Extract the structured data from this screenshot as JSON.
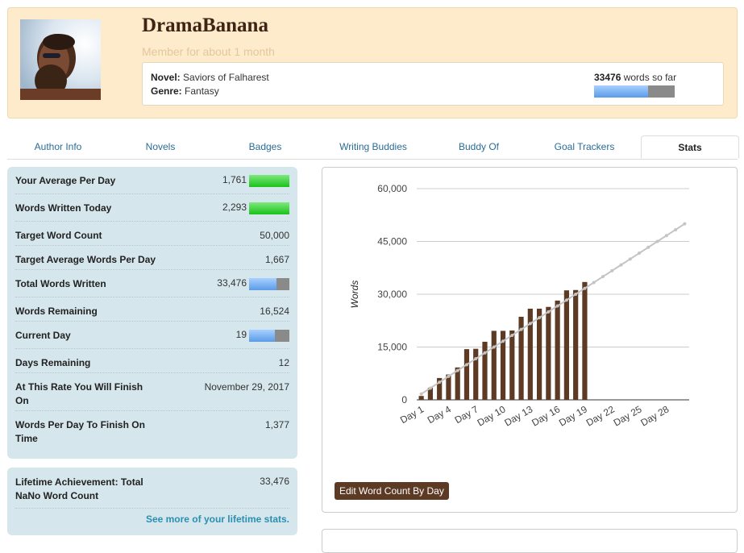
{
  "profile": {
    "username": "DramaBanana",
    "member_since": "Member for about 1 month",
    "novel_label": "Novel:",
    "novel_title": "Saviors of Falharest",
    "genre_label": "Genre:",
    "genre": "Fantasy",
    "words_count": "33476",
    "words_suffix": "words so far",
    "progress_fraction": 0.67
  },
  "tabs": [
    {
      "label": "Author Info",
      "active": false
    },
    {
      "label": "Novels",
      "active": false
    },
    {
      "label": "Badges",
      "active": false
    },
    {
      "label": "Writing Buddies",
      "active": false
    },
    {
      "label": "Buddy Of",
      "active": false
    },
    {
      "label": "Goal Trackers",
      "active": false
    },
    {
      "label": "Stats",
      "active": true
    }
  ],
  "stats": [
    {
      "label": "Your Average Per Day",
      "value": "1,761",
      "bar": "green",
      "fill": 1.0
    },
    {
      "label": "Words Written Today",
      "value": "2,293",
      "bar": "green",
      "fill": 1.0
    },
    {
      "label": "Target Word Count",
      "value": "50,000"
    },
    {
      "label": "Target Average Words Per Day",
      "value": "1,667"
    },
    {
      "label": "Total Words Written",
      "value": "33,476",
      "bar": "blue",
      "fill": 0.67
    },
    {
      "label": "Words Remaining",
      "value": "16,524"
    },
    {
      "label": "Current Day",
      "value": "19",
      "bar": "blue",
      "fill": 0.63
    },
    {
      "label": "Days Remaining",
      "value": "12"
    },
    {
      "label": "At This Rate You Will Finish On",
      "value": "November 29, 2017"
    },
    {
      "label": "Words Per Day To Finish On Time",
      "value": "1,377"
    }
  ],
  "lifetime": {
    "label": "Lifetime Achievement: Total NaNo Word Count",
    "value": "33,476",
    "link": "See more of your lifetime stats."
  },
  "edit_button": "Edit Word Count By Day",
  "chart_data": {
    "type": "bar",
    "ylabel": "Words",
    "ylim": [
      0,
      60000
    ],
    "yticks": [
      0,
      15000,
      30000,
      45000,
      60000
    ],
    "ytick_labels": [
      "0",
      "15,000",
      "30,000",
      "45,000",
      "60,000"
    ],
    "categories": [
      "Day 1",
      "Day 2",
      "Day 3",
      "Day 4",
      "Day 5",
      "Day 6",
      "Day 7",
      "Day 8",
      "Day 9",
      "Day 10",
      "Day 11",
      "Day 12",
      "Day 13",
      "Day 14",
      "Day 15",
      "Day 16",
      "Day 17",
      "Day 18",
      "Day 19",
      "Day 20",
      "Day 21",
      "Day 22",
      "Day 23",
      "Day 24",
      "Day 25",
      "Day 26",
      "Day 27",
      "Day 28",
      "Day 29",
      "Day 30"
    ],
    "xtick_labels": [
      "Day 1",
      "Day 4",
      "Day 7",
      "Day 10",
      "Day 13",
      "Day 16",
      "Day 19",
      "Day 22",
      "Day 25",
      "Day 28"
    ],
    "series": [
      {
        "type": "bar",
        "color": "#5c3a23",
        "values": [
          1100,
          3400,
          6200,
          7200,
          9200,
          14400,
          14500,
          16500,
          19600,
          19600,
          19700,
          23600,
          25900,
          25900,
          26400,
          28200,
          31100,
          31200,
          33476,
          null,
          null,
          null,
          null,
          null,
          null,
          null,
          null,
          null,
          null,
          null
        ]
      },
      {
        "type": "line",
        "color": "#c4c4c4",
        "values": [
          1667,
          3333,
          5000,
          6667,
          8333,
          10000,
          11667,
          13333,
          15000,
          16667,
          18333,
          20000,
          21667,
          23333,
          25000,
          26667,
          28333,
          30000,
          31667,
          33333,
          35000,
          36667,
          38333,
          40000,
          41667,
          43333,
          45000,
          46667,
          48333,
          50000
        ]
      }
    ],
    "grid": true
  }
}
